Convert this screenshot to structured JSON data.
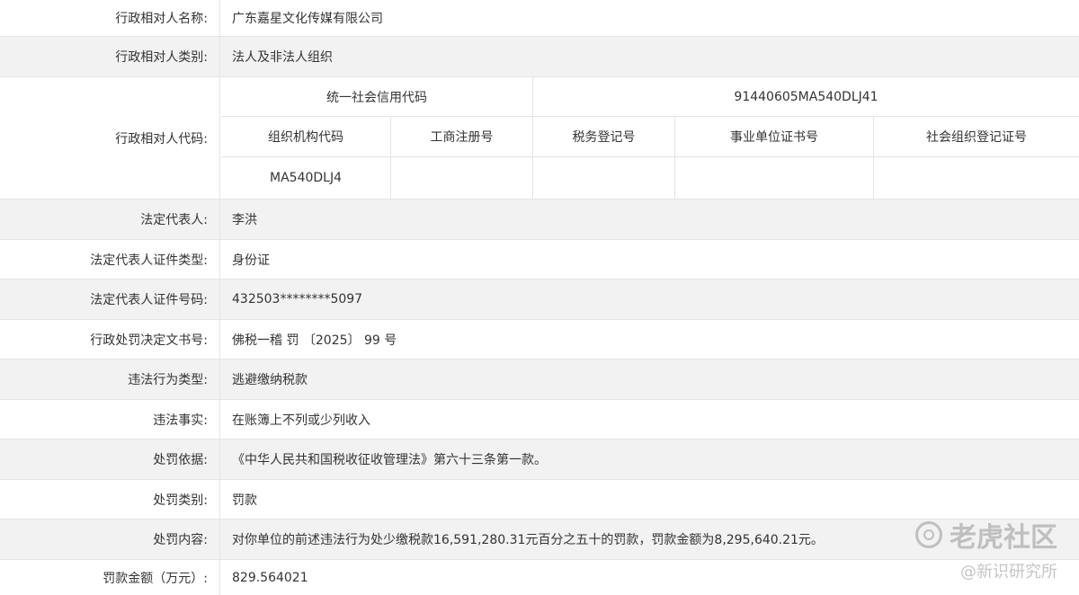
{
  "rows": {
    "name": {
      "label": "行政相对人名称:",
      "value": "广东嘉星文化传媒有限公司"
    },
    "category": {
      "label": "行政相对人类别:",
      "value": "法人及非法人组织"
    },
    "code": {
      "label": "行政相对人代码:",
      "credit_code_label": "统一社会信用代码",
      "credit_code_value": "91440605MA540DLJ41",
      "headers": [
        "组织机构代码",
        "工商注册号",
        "税务登记号",
        "事业单位证书号",
        "社会组织登记证号"
      ],
      "values": [
        "MA540DLJ4",
        "",
        "",
        "",
        ""
      ]
    },
    "legal_rep": {
      "label": "法定代表人:",
      "value": "李洪"
    },
    "id_type": {
      "label": "法定代表人证件类型:",
      "value": "身份证"
    },
    "id_number": {
      "label": "法定代表人证件号码:",
      "value": "432503********5097"
    },
    "decision_no": {
      "label": "行政处罚决定文书号:",
      "value": "佛税一稽 罚 〔2025〕 99 号"
    },
    "violation_type": {
      "label": "违法行为类型:",
      "value": "逃避缴纳税款"
    },
    "violation_fact": {
      "label": "违法事实:",
      "value": "在账簿上不列或少列收入"
    },
    "basis": {
      "label": "处罚依据:",
      "value": "《中华人民共和国税收征收管理法》第六十三条第一款。"
    },
    "penalty_type": {
      "label": "处罚类别:",
      "value": "罚款"
    },
    "penalty_content": {
      "label": "处罚内容:",
      "value": "对你单位的前述违法行为处少缴税款16,591,280.31元百分之五十的罚款，罚款金额为8,295,640.21元。"
    },
    "fine_amount": {
      "label": "罚款金额（万元）:",
      "value": "829.564021"
    }
  },
  "watermark": {
    "logo_text": "老虎社区",
    "sub_text": "@新识研究所"
  }
}
